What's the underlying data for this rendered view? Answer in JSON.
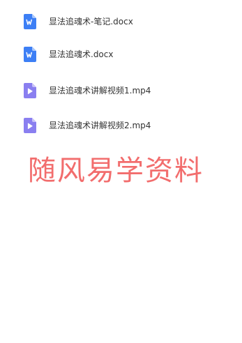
{
  "files": [
    {
      "name": "显法追魂术-笔记.docx",
      "icon": "word-doc-icon",
      "color": "#3d7ff5"
    },
    {
      "name": "显法追魂术.docx",
      "icon": "word-doc-icon",
      "color": "#3d7ff5"
    },
    {
      "name": "显法追魂术讲解视频1.mp4",
      "icon": "video-file-icon",
      "color": "#8a7ff0"
    },
    {
      "name": "显法追魂术讲解视频2.mp4",
      "icon": "video-file-icon",
      "color": "#8a7ff0"
    }
  ],
  "watermark": {
    "text": "随风易学资料",
    "color": "#f26d6d"
  }
}
